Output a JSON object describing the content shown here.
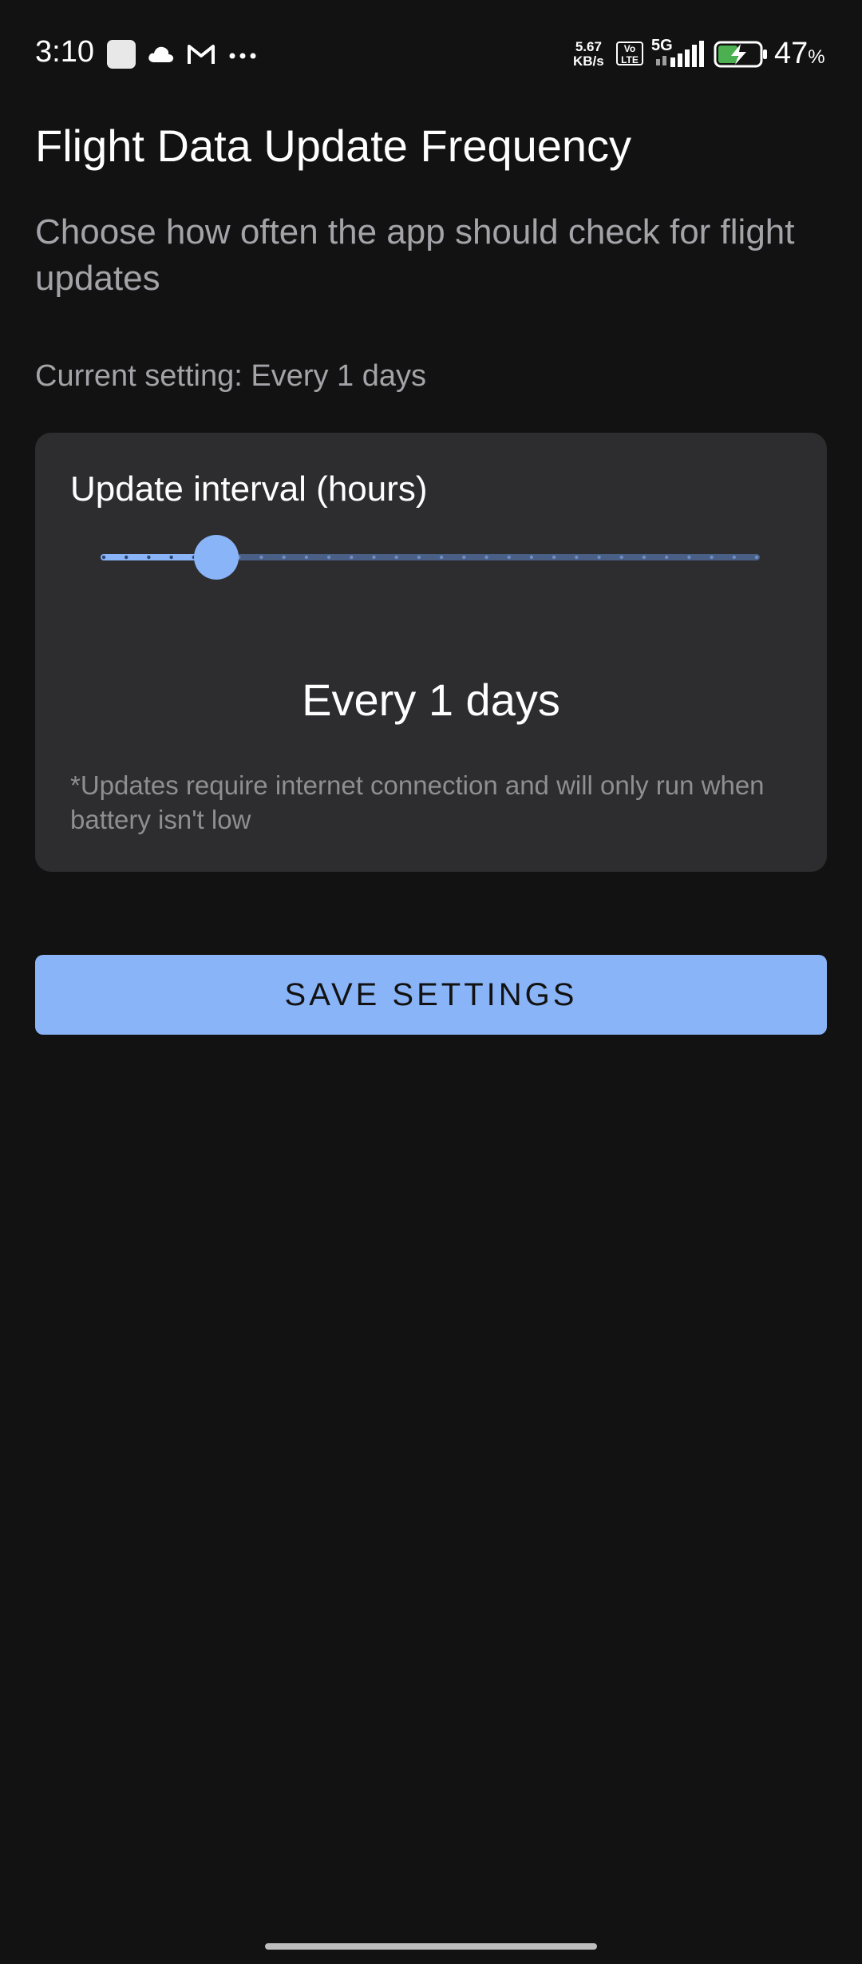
{
  "status_bar": {
    "time": "3:10",
    "network_speed_value": "5.67",
    "network_speed_unit": "KB/s",
    "volte_top": "Vo",
    "volte_bottom": "LTE",
    "network_type": "5G",
    "battery_percent": "47",
    "battery_percent_sign": "%",
    "battery_level": 0.47,
    "battery_color": "#4caf50"
  },
  "header": {
    "title": "Flight Data Update Frequency",
    "subtitle": "Choose how often the app should check for flight updates"
  },
  "current_setting": "Current setting: Every 1 days",
  "interval_card": {
    "label": "Update interval (hours)",
    "slider": {
      "min": 1,
      "max": 30,
      "value": 6,
      "accent": "#8ab4f8",
      "track_inactive": "#4a5f86"
    },
    "value_display": "Every 1 days",
    "note": "*Updates require internet connection and will only run when battery isn't low"
  },
  "actions": {
    "save_label": "SAVE SETTINGS",
    "save_color": "#8ab4f8"
  },
  "icons": {
    "notification_app": "square-app-icon",
    "cloud": "cloud-icon",
    "gmail": "gmail-icon",
    "more": "more-dots-icon",
    "signal": "signal-bars-icon",
    "battery": "battery-charging-icon"
  }
}
